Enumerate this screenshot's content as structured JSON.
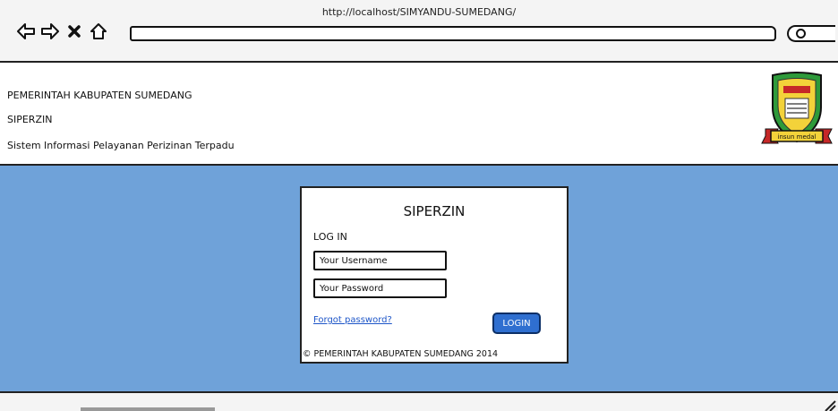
{
  "browser": {
    "url": "http://localhost/SIMYANDU-SUMEDANG/"
  },
  "header": {
    "line1": "PEMERINTAH KABUPATEN SUMEDANG",
    "line2": "SIPERZIN",
    "line3": "Sistem Informasi Pelayanan Perizinan Terpadu",
    "logo_text": "insun medal",
    "logo_icon": "sumedang-crest-icon"
  },
  "login": {
    "title": "SIPERZIN",
    "subtitle": "LOG IN",
    "username_placeholder": "Your Username",
    "password_placeholder": "Your Password",
    "forgot_label": "Forgot password?",
    "login_label": "LOGIN",
    "copyright": "© PEMERINTAH KABUPATEN SUMEDANG 2014"
  },
  "colors": {
    "background": "#6fa2d9",
    "button": "#2f6fd0",
    "link": "#1e56c8"
  }
}
